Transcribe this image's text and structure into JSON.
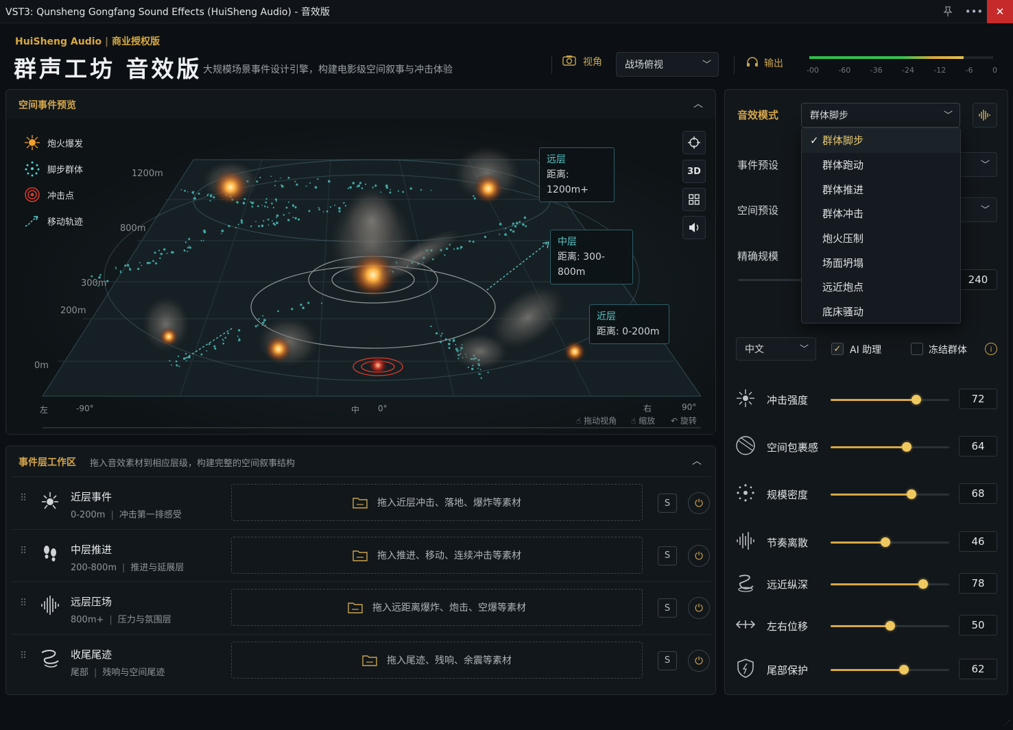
{
  "window": {
    "title": "VST3: Qunsheng Gongfang Sound Effects (HuiSheng Audio) - 音效版"
  },
  "header": {
    "brand": "HuiSheng Audio",
    "license": "商业授权版",
    "title": "群声工坊 音效版",
    "subtitle": "大规模场景事件设计引擎，构建电影级空间叙事与冲击体验",
    "view_label": "视角",
    "view_value": "战场俯视",
    "output_label": "输出",
    "meter_level": 0.84,
    "meter_scale": [
      "-00",
      "-60",
      "-36",
      "-24",
      "-12",
      "-6",
      "0"
    ]
  },
  "preview": {
    "title": "空间事件预览",
    "legend": [
      {
        "label": "炮火爆发",
        "icon": "explosion-icon"
      },
      {
        "label": "脚步群体",
        "icon": "footsteps-cluster-icon"
      },
      {
        "label": "冲击点",
        "icon": "impact-point-icon"
      },
      {
        "label": "移动轨迹",
        "icon": "trajectory-icon"
      }
    ],
    "distances": [
      "1200m",
      "800m",
      "300m",
      "200m",
      "0m"
    ],
    "angles": {
      "left": "左",
      "left_deg": "-90°",
      "center": "中",
      "center_deg": "0°",
      "right": "右",
      "right_deg": "90°"
    },
    "zones": [
      {
        "name": "远层",
        "dist": "距离: 1200m+"
      },
      {
        "name": "中层",
        "dist": "距离: 300-800m"
      },
      {
        "name": "近层",
        "dist": "距离: 0-200m"
      }
    ],
    "tools": {
      "view3d": "3D"
    },
    "hints": {
      "drag": "拖动视角",
      "zoom": "缩放",
      "rotate": "旋转"
    }
  },
  "layers": {
    "title": "事件层工作区",
    "subtitle": "拖入音效素材到相应层级，构建完整的空间叙事结构",
    "solo": "S",
    "rows": [
      {
        "name": "近层事件",
        "range": "0-200m",
        "desc": "冲击第一排感受",
        "drop": "拖入近层冲击、落地、爆炸等素材"
      },
      {
        "name": "中层推进",
        "range": "200-800m",
        "desc": "推进与延展层",
        "drop": "拖入推进、移动、连续冲击等素材"
      },
      {
        "name": "远层压场",
        "range": "800m+",
        "desc": "压力与氛围层",
        "drop": "拖入远距离爆炸、炮击、空爆等素材"
      },
      {
        "name": "收尾尾迹",
        "range": "尾部",
        "desc": "残响与空间尾迹",
        "drop": "拖入尾迹、残响、余震等素材"
      }
    ]
  },
  "controls": {
    "mode_label": "音效模式",
    "mode_value": "群体脚步",
    "menu_items": [
      "群体脚步",
      "群体跑动",
      "群体推进",
      "群体冲击",
      "炮火压制",
      "场面坍塌",
      "远近炮点",
      "底床骚动"
    ],
    "event_preset_label": "事件预设",
    "space_preset_label": "空间预设",
    "scale_label": "精确规模",
    "scale_value": "240",
    "language": "中文",
    "ai_label": "AI 助理",
    "ai_checked": true,
    "freeze_label": "冻结群体",
    "freeze_checked": false,
    "sliders": [
      {
        "label": "冲击强度",
        "value": 72,
        "icon": "impact-burst-icon"
      },
      {
        "label": "空间包裹感",
        "value": 64,
        "icon": "sphere-wrap-icon"
      },
      {
        "label": "规模密度",
        "value": 68,
        "icon": "density-dots-icon"
      },
      {
        "label": "节奏离散",
        "value": 46,
        "icon": "rhythm-wave-icon"
      },
      {
        "label": "远近纵深",
        "value": 78,
        "icon": "depth-spiral-icon"
      },
      {
        "label": "左右位移",
        "value": 50,
        "icon": "pan-arrows-icon"
      },
      {
        "label": "尾部保护",
        "value": 62,
        "icon": "shield-icon"
      }
    ]
  },
  "colors": {
    "accent": "#d4a64a",
    "teal": "#5cc6c6",
    "close": "#c62a2a"
  }
}
